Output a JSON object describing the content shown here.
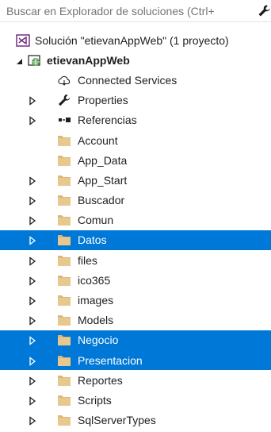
{
  "search": {
    "placeholder": "Buscar en Explorador de soluciones (Ctrl+ ",
    "icon": "wrench-icon"
  },
  "colors": {
    "selection": "#0078d7",
    "folder": "#dcb67a",
    "solution_icon": "#68217a",
    "project_icon": "#388a34"
  },
  "tree": {
    "solution_label": "Solución \"etievanAppWeb\" (1 proyecto)",
    "project_label": "etievanAppWeb",
    "items": [
      {
        "label": "Connected Services",
        "icon": "connected-services-icon",
        "expandable": false,
        "selected": false
      },
      {
        "label": "Properties",
        "icon": "wrench-icon",
        "expandable": true,
        "selected": false
      },
      {
        "label": "Referencias",
        "icon": "references-icon",
        "expandable": true,
        "selected": false
      },
      {
        "label": "Account",
        "icon": "folder-icon",
        "expandable": false,
        "selected": false
      },
      {
        "label": "App_Data",
        "icon": "folder-icon",
        "expandable": false,
        "selected": false
      },
      {
        "label": "App_Start",
        "icon": "folder-icon",
        "expandable": true,
        "selected": false
      },
      {
        "label": "Buscador",
        "icon": "folder-icon",
        "expandable": true,
        "selected": false
      },
      {
        "label": "Comun",
        "icon": "folder-icon",
        "expandable": true,
        "selected": false
      },
      {
        "label": "Datos",
        "icon": "folder-icon",
        "expandable": true,
        "selected": true
      },
      {
        "label": "files",
        "icon": "folder-icon",
        "expandable": true,
        "selected": false
      },
      {
        "label": "ico365",
        "icon": "folder-icon",
        "expandable": true,
        "selected": false
      },
      {
        "label": "images",
        "icon": "folder-icon",
        "expandable": true,
        "selected": false
      },
      {
        "label": "Models",
        "icon": "folder-icon",
        "expandable": true,
        "selected": false
      },
      {
        "label": "Negocio",
        "icon": "folder-icon",
        "expandable": true,
        "selected": true
      },
      {
        "label": "Presentacion",
        "icon": "folder-icon",
        "expandable": true,
        "selected": true
      },
      {
        "label": "Reportes",
        "icon": "folder-icon",
        "expandable": true,
        "selected": false
      },
      {
        "label": "Scripts",
        "icon": "folder-icon",
        "expandable": true,
        "selected": false
      },
      {
        "label": "SqlServerTypes",
        "icon": "folder-icon",
        "expandable": true,
        "selected": false
      }
    ]
  }
}
